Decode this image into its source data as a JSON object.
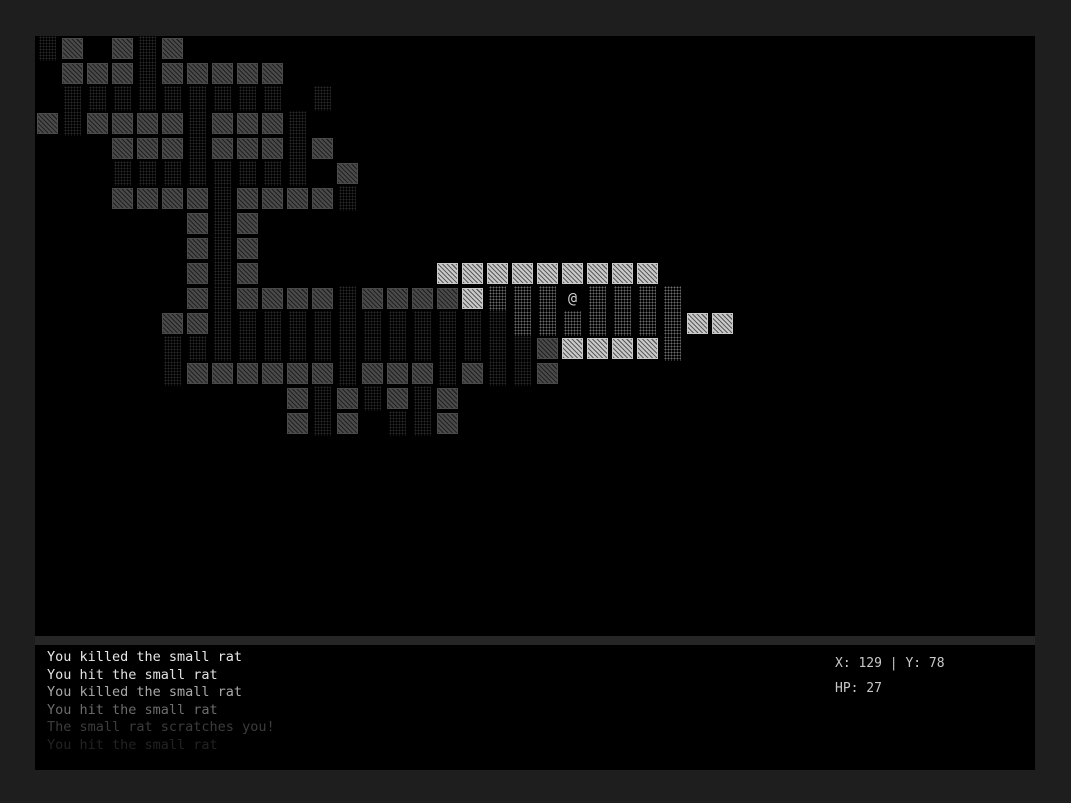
{
  "map": {
    "player_glyph": "@",
    "colors": {
      "background": "#000000",
      "wall_remembered": "#4a4a4a",
      "floor_remembered": "#2a2a2a",
      "wall_visible": "#c9c9c9",
      "floor_visible": "#6c6c6c",
      "player": "#cfcfcf"
    },
    "legend": {
      "W": "wall-remembered",
      ".": "floor-remembered",
      "V": "wall-visible",
      ",": "floor-visible",
      "@": "player"
    },
    "rows": [
      ".W W.W",
      " WWW.WWWWW",
      " ......... .",
      "W.WWWW.WWW.",
      "   WWW.WWW.W",
      "   ........ W",
      "   WWWW.WWWW.",
      "      W.W",
      "      W.W",
      "      W.W       VVVVVVVVV",
      "      W.WWWW.WWWWV,,,@,,,,",
      "     WW............,,,,,,,VV",
      "     ...............WVVVV,",
      "     .WWWWWW.WWW.W..W",
      "          W.W.W.W",
      "          W.W ..W"
    ]
  },
  "log": {
    "messages": [
      {
        "text": "You killed the small rat",
        "color": "#e8e8e8"
      },
      {
        "text": "You hit the small rat",
        "color": "#e0e0e0"
      },
      {
        "text": "You killed the small rat",
        "color": "#a8a8a8"
      },
      {
        "text": "You hit the small rat",
        "color": "#6c6c6c"
      },
      {
        "text": "The small rat scratches you!",
        "color": "#3c3c3c"
      },
      {
        "text": "You hit the small rat",
        "color": "#222222"
      }
    ]
  },
  "stats": {
    "position": "X: 129 | Y: 78",
    "hp": "HP: 27"
  }
}
